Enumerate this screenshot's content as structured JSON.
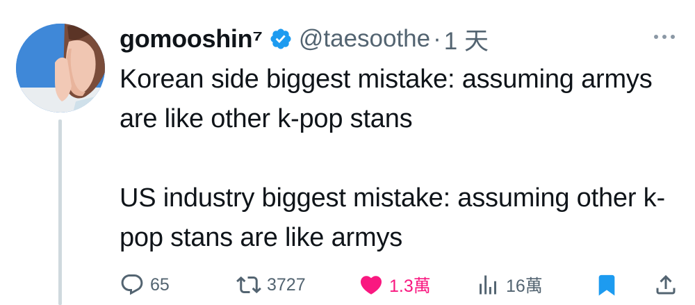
{
  "tweet": {
    "author": {
      "display_name": "gomooshin⁷",
      "handle": "@taesoothe",
      "verified": true
    },
    "separator": "·",
    "time": "1 天",
    "text_paragraphs": [
      "Korean side biggest mistake: assuming armys are like other k-pop stans",
      "US industry biggest mistake: assuming other k-pop stans are like armys"
    ]
  },
  "actions": {
    "reply_count": "65",
    "retweet_count": "3727",
    "like_count": "1.3萬",
    "views_count": "16萬"
  },
  "icons": {
    "avatar": "avatar-photo",
    "verified": "verified-badge-icon",
    "more": "more-options-icon",
    "reply": "reply-icon",
    "retweet": "retweet-icon",
    "like": "heart-icon",
    "views": "views-chart-icon",
    "bookmark": "bookmark-icon",
    "share": "share-icon"
  },
  "colors": {
    "text": "#0f1419",
    "secondary": "#536471",
    "verified": "#1d9bf0",
    "like": "#f91880",
    "bookmark": "#1d9bf0",
    "thread_line": "#cfd9de"
  }
}
